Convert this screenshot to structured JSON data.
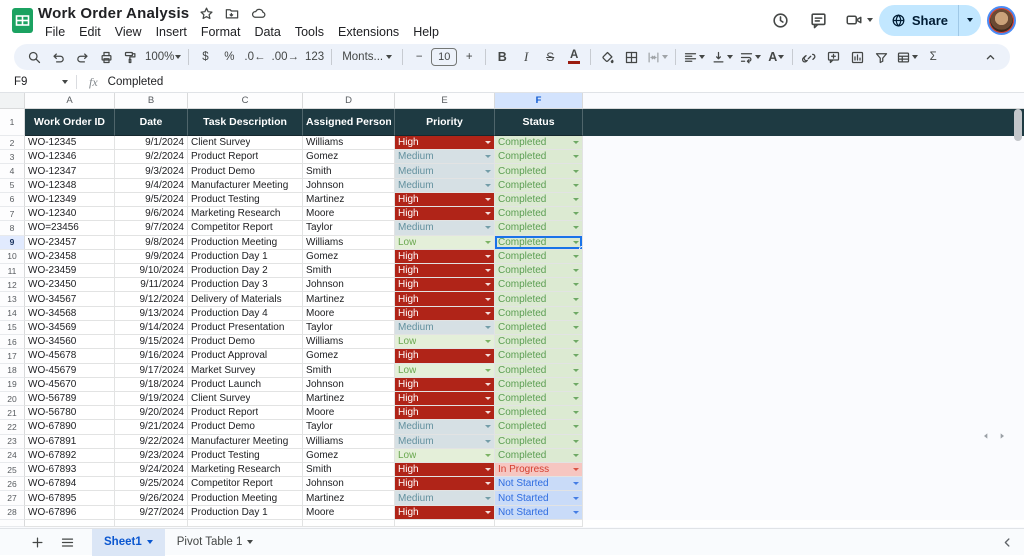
{
  "titlebar": {
    "title": "Work Order Analysis",
    "menus": [
      "File",
      "Edit",
      "View",
      "Insert",
      "Format",
      "Data",
      "Tools",
      "Extensions",
      "Help"
    ],
    "share_label": "Share"
  },
  "toolbar": {
    "zoom": "100%",
    "currency": "$",
    "percent": "%",
    "decrease_decimals": ".0",
    "increase_decimals": ".00",
    "more_formats": "123",
    "font_name": "Monts...",
    "minus": "−",
    "font_size": "10",
    "plus": "+",
    "bold": "B",
    "italic": "I",
    "strikethrough": "S",
    "text_color": "A",
    "rotation": "A",
    "sum": "Σ"
  },
  "formula_bar": {
    "cell_ref": "F9",
    "value": "Completed"
  },
  "grid": {
    "column_letters": [
      "A",
      "B",
      "C",
      "D",
      "E",
      "F"
    ],
    "selected_column": "F",
    "selected_row": 9,
    "header": [
      "Work Order ID",
      "Date",
      "Task Description",
      "Assigned Person",
      "Priority",
      "Status"
    ],
    "rows": [
      [
        "WO-12345",
        "9/1/2024",
        "Client Survey",
        "Williams",
        "High",
        "Completed"
      ],
      [
        "WO-12346",
        "9/2/2024",
        "Product Report",
        "Gomez",
        "Medium",
        "Completed"
      ],
      [
        "WO-12347",
        "9/3/2024",
        "Product Demo",
        "Smith",
        "Medium",
        "Completed"
      ],
      [
        "WO-12348",
        "9/4/2024",
        "Manufacturer Meeting",
        "Johnson",
        "Medium",
        "Completed"
      ],
      [
        "WO-12349",
        "9/5/2024",
        "Product Testing",
        "Martinez",
        "High",
        "Completed"
      ],
      [
        "WO-12340",
        "9/6/2024",
        "Marketing Research",
        "Moore",
        "High",
        "Completed"
      ],
      [
        "WO=23456",
        "9/7/2024",
        "Competitor Report",
        "Taylor",
        "Medium",
        "Completed"
      ],
      [
        "WO-23457",
        "9/8/2024",
        "Production Meeting",
        "Williams",
        "Low",
        "Completed"
      ],
      [
        "WO-23458",
        "9/9/2024",
        "Production Day 1",
        "Gomez",
        "High",
        "Completed"
      ],
      [
        "WO-23459",
        "9/10/2024",
        "Production Day 2",
        "Smith",
        "High",
        "Completed"
      ],
      [
        "WO-23450",
        "9/11/2024",
        "Production Day 3",
        "Johnson",
        "High",
        "Completed"
      ],
      [
        "WO-34567",
        "9/12/2024",
        "Delivery of Materials",
        "Martinez",
        "High",
        "Completed"
      ],
      [
        "WO-34568",
        "9/13/2024",
        "Production Day 4",
        "Moore",
        "High",
        "Completed"
      ],
      [
        "WO-34569",
        "9/14/2024",
        "Product Presentation",
        "Taylor",
        "Medium",
        "Completed"
      ],
      [
        "WO-34560",
        "9/15/2024",
        "Product Demo",
        "Williams",
        "Low",
        "Completed"
      ],
      [
        "WO-45678",
        "9/16/2024",
        "Product Approval",
        "Gomez",
        "High",
        "Completed"
      ],
      [
        "WO-45679",
        "9/17/2024",
        "Market Survey",
        "Smith",
        "Low",
        "Completed"
      ],
      [
        "WO-45670",
        "9/18/2024",
        "Product Launch",
        "Johnson",
        "High",
        "Completed"
      ],
      [
        "WO-56789",
        "9/19/2024",
        "Client Survey",
        "Martinez",
        "High",
        "Completed"
      ],
      [
        "WO-56780",
        "9/20/2024",
        "Product Report",
        "Moore",
        "High",
        "Completed"
      ],
      [
        "WO-67890",
        "9/21/2024",
        "Product Demo",
        "Taylor",
        "Medium",
        "Completed"
      ],
      [
        "WO-67891",
        "9/22/2024",
        "Manufacturer Meeting",
        "Williams",
        "Medium",
        "Completed"
      ],
      [
        "WO-67892",
        "9/23/2024",
        "Product Testing",
        "Gomez",
        "Low",
        "Completed"
      ],
      [
        "WO-67893",
        "9/24/2024",
        "Marketing Research",
        "Smith",
        "High",
        "In Progress"
      ],
      [
        "WO-67894",
        "9/25/2024",
        "Competitor Report",
        "Johnson",
        "High",
        "Not Started"
      ],
      [
        "WO-67895",
        "9/26/2024",
        "Production Meeting",
        "Martinez",
        "Medium",
        "Not Started"
      ],
      [
        "WO-67896",
        "9/27/2024",
        "Production Day 1",
        "Moore",
        "High",
        "Not Started"
      ]
    ]
  },
  "sheet_tabs": {
    "tabs": [
      "Sheet1",
      "Pivot Table 1"
    ],
    "active": "Sheet1"
  },
  "colors": {
    "accent_blue": "#1a73e8",
    "table_header_bg": "#1e3a42",
    "priority": {
      "High": {
        "bg": "#b02418",
        "fg": "#ffffff"
      },
      "Medium": {
        "bg": "#d6e0e4",
        "fg": "#62909e"
      },
      "Low": {
        "bg": "#e4efd9",
        "fg": "#6aa84f"
      }
    },
    "status": {
      "Completed": {
        "bg": "#dcead2",
        "fg": "#5b9e52"
      },
      "In Progress": {
        "bg": "#f6c6c1",
        "fg": "#d43e2e"
      },
      "Not Started": {
        "bg": "#c9dbf8",
        "fg": "#2e6ce0"
      }
    }
  }
}
